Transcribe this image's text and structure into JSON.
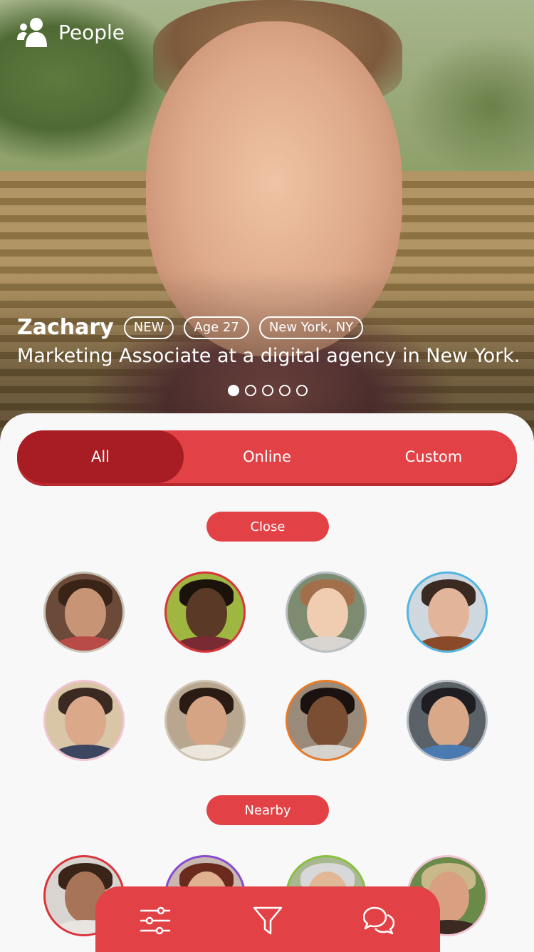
{
  "header": {
    "title": "People",
    "icon": "people-icon"
  },
  "profile": {
    "name": "Zachary",
    "badge": "NEW",
    "age": "Age 27",
    "location": "New York, NY",
    "description": "Marketing Associate at a digital agency in New York.",
    "photo_count": 5,
    "active_photo": 1
  },
  "tabs": [
    {
      "label": "All",
      "active": true
    },
    {
      "label": "Online",
      "active": false
    },
    {
      "label": "Custom",
      "active": false
    }
  ],
  "sections": [
    {
      "label": "Close"
    },
    {
      "label": "Nearby"
    }
  ],
  "colors": {
    "accent": "#e24246",
    "accent_dark": "#a81d23",
    "sheet": "#f8f8f9"
  },
  "bottom_bar": {
    "icons": [
      "sliders-icon",
      "filter-icon",
      "chat-icon"
    ]
  }
}
